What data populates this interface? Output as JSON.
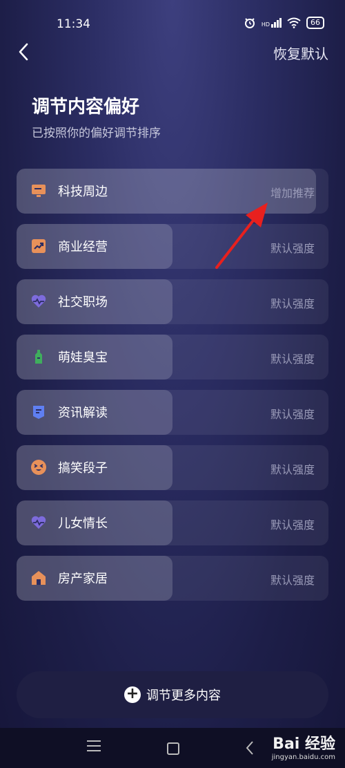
{
  "status": {
    "time": "11:34",
    "net_label": "HD",
    "battery": "66"
  },
  "header": {
    "reset_label": "恢复默认"
  },
  "title": "调节内容偏好",
  "subtitle": "已按照你的偏好调节排序",
  "categories": [
    {
      "label": "科技周边",
      "level": "增加推荐",
      "fill": 0.96,
      "icon": "monitor-icon",
      "color": "#e8915a"
    },
    {
      "label": "商业经营",
      "level": "默认强度",
      "fill": 0.5,
      "icon": "trend-chart-icon",
      "color": "#e8915a"
    },
    {
      "label": "社交职场",
      "level": "默认强度",
      "fill": 0.5,
      "icon": "heartbeat-icon",
      "color": "#7d6bdc"
    },
    {
      "label": "萌娃臭宝",
      "level": "默认强度",
      "fill": 0.5,
      "icon": "baby-bottle-icon",
      "color": "#3fae5d"
    },
    {
      "label": "资讯解读",
      "level": "默认强度",
      "fill": 0.5,
      "icon": "bookmark-icon",
      "color": "#5f7ff2"
    },
    {
      "label": "搞笑段子",
      "level": "默认强度",
      "fill": 0.5,
      "icon": "laugh-face-icon",
      "color": "#e8915a"
    },
    {
      "label": "儿女情长",
      "level": "默认强度",
      "fill": 0.5,
      "icon": "heartbeat-icon",
      "color": "#7d6bdc"
    },
    {
      "label": "房产家居",
      "level": "默认强度",
      "fill": 0.5,
      "icon": "house-icon",
      "color": "#e8915a"
    }
  ],
  "more_button": {
    "label": "调节更多内容"
  },
  "watermark": {
    "brand": "Bai 经验",
    "url": "jingyan.baidu.com"
  }
}
